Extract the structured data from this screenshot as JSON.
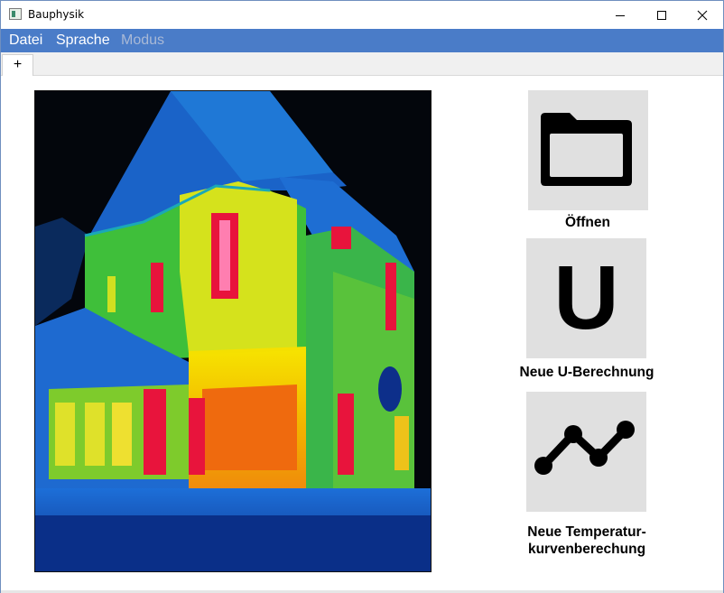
{
  "window": {
    "title": "Bauphysik",
    "controls": [
      "minimize",
      "maximize",
      "close"
    ]
  },
  "menu": {
    "items": [
      {
        "label": "Datei",
        "enabled": true
      },
      {
        "label": "Sprache",
        "enabled": true
      },
      {
        "label": "Modus",
        "enabled": false
      }
    ]
  },
  "tabs": {
    "add_label": "+"
  },
  "image": {
    "icon": "thermal-house-image"
  },
  "actions": {
    "open": {
      "label": "Öffnen",
      "icon": "folder-icon"
    },
    "u_calc": {
      "label": "Neue U-Berechnung",
      "icon": "u-letter-icon",
      "letter": "U"
    },
    "temp_curve": {
      "label_line1": "Neue Temperatur-",
      "label_line2": "kurvenberechung",
      "icon": "line-chart-icon"
    }
  },
  "colors": {
    "menubar": "#4a7cc8",
    "tile": "#e0e0e0",
    "disabled_menu": "#a9b9d6"
  }
}
